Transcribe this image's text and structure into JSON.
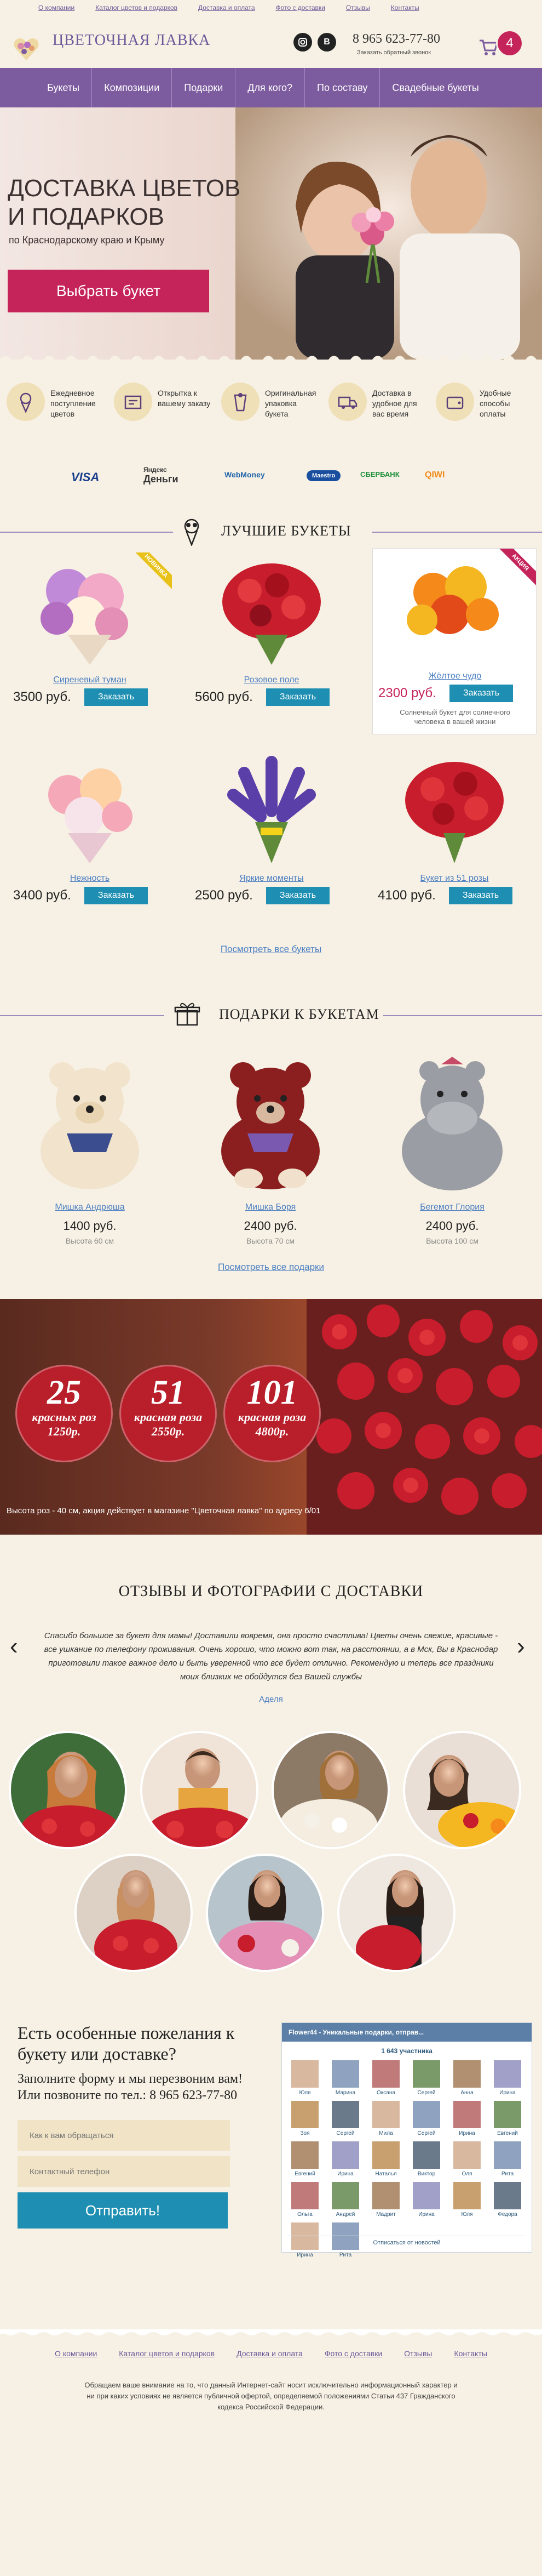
{
  "top_nav": [
    "О компании",
    "Каталог цветов и подарков",
    "Доставка и оплата",
    "Фото с доставки",
    "Отзывы",
    "Контакты"
  ],
  "header": {
    "logo_text": "ЦВЕТОЧНАЯ ЛАВКА",
    "phone": "8 965 623-77-80",
    "callback_label": "Заказать обратный звонок",
    "cart_count": "4",
    "social": [
      {
        "icon": "instagram-icon"
      },
      {
        "icon": "vk-icon",
        "label": "В"
      }
    ]
  },
  "main_nav": [
    "Букеты",
    "Композиции",
    "Подарки",
    "Для кого?",
    "По составу",
    "Свадебные букеты"
  ],
  "hero": {
    "title_1": "ДОСТАВКА ЦВЕТОВ",
    "title_2": "И ПОДАРКОВ",
    "subtitle": "по Краснодарскому краю и Крыму",
    "button": "Выбрать букет"
  },
  "features": [
    {
      "icon": "bouquet-icon",
      "text": "Ежедневное поступление цветов"
    },
    {
      "icon": "card-icon",
      "text": "Открытка к вашему заказу"
    },
    {
      "icon": "package-icon",
      "text": "Оригинальная упаковка букета"
    },
    {
      "icon": "truck-icon",
      "text": "Доставка в удобное для вас время"
    },
    {
      "icon": "wallet-icon",
      "text": "Удобные способы оплаты"
    }
  ],
  "payments": {
    "visa": "VISA",
    "yandex_1": "Яндекс",
    "yandex_2": "Деньги",
    "webmoney": "WebMoney",
    "maestro": "Maestro",
    "sberbank": "СБЕРБАНК",
    "qiwi": "QIWI"
  },
  "best": {
    "title": "ЛУЧШИЕ БУКЕТЫ",
    "order_label": "Заказать",
    "see_all": "Посмотреть все букеты",
    "items": [
      {
        "name": "Сиреневый туман",
        "price": "3500 руб.",
        "badge": "НОВИНКА",
        "colors": [
          "#c18ad9",
          "#f2a9c8",
          "#fff3e0"
        ]
      },
      {
        "name": "Розовое поле",
        "price": "5600 руб.",
        "colors": [
          "#c81d2c",
          "#e23a3f",
          "#8f0f1c"
        ]
      },
      {
        "name": "Жёлтое чудо",
        "price": "2300 руб.",
        "badge": "АКЦИЯ",
        "desc": "Солнечный букет для солнечного человека в вашей жизни",
        "colors": [
          "#f58a1b",
          "#f4b722",
          "#e24a1a"
        ]
      },
      {
        "name": "Нежность",
        "price": "3400 руб.",
        "colors": [
          "#f5a9b8",
          "#fdd1a3",
          "#f7e3ea"
        ]
      },
      {
        "name": "Яркие моменты",
        "price": "2500 руб.",
        "colors": [
          "#5a3fa8",
          "#7b5bcf",
          "#3e2c82"
        ]
      },
      {
        "name": "Букет из 51 розы",
        "price": "4100 руб.",
        "colors": [
          "#c81d2c",
          "#a5101d",
          "#e0343b"
        ]
      }
    ]
  },
  "gifts": {
    "title": "ПОДАРКИ К БУКЕТАМ",
    "see_all": "Посмотреть все подарки",
    "items": [
      {
        "name": "Мишка Андрюша",
        "price": "1400 руб.",
        "height": "Высота 60 см",
        "color": "#f2e4cc",
        "accent": "#3b4d8e"
      },
      {
        "name": "Мишка Боря",
        "price": "2400 руб.",
        "height": "Высота 70 см",
        "color": "#8b1e1e",
        "accent": "#7a5ab0"
      },
      {
        "name": "Бегемот Глория",
        "price": "2400 руб.",
        "height": "Высота 100 см",
        "color": "#9a9da3",
        "accent": "#c64b66"
      }
    ]
  },
  "promo": {
    "offers": [
      {
        "num": "25",
        "line1": "красных роз",
        "line2": "1250р."
      },
      {
        "num": "51",
        "line1": "красная роза",
        "line2": "2550р."
      },
      {
        "num": "101",
        "line1": "красная роза",
        "line2": "4800р."
      }
    ],
    "note": "Высота роз - 40 см, акция действует в магазине \"Цветочная лавка\" по адресу 6/01"
  },
  "reviews": {
    "title": "ОТЗЫВЫ И ФОТОГРАФИИ С ДОСТАВКИ",
    "text": "Спасибо большое за букет для мамы! Доставили вовремя, она просто счастлива! Цветы очень свежие, красивые - все ушкание по телефону проживания. Очень хорошо, что можно вот так, на расстоянии, а в Мск, Вы в Краснодар приготовили такое важное дело и быть уверенной что все будет отлично. Рекомендую и теперь все праздники моих близких не обойдутся без Вашей службы",
    "author": "Аделя"
  },
  "contact": {
    "title": "Есть особенные пожелания к букету или доставке?",
    "sub_1": "Заполните форму и мы перезвоним вам!",
    "sub_2": "Или позвоните по тел.: 8 965 623-77-80",
    "name_placeholder": "Как к вам обращаться",
    "phone_placeholder": "Контактный телефон",
    "button": "Отправить!",
    "vk": {
      "group": "Flower44 - Уникальные подарки, отправ...",
      "members": "1 643 участника",
      "unsubscribe": "Отписаться от новостей",
      "people": [
        "Юля",
        "Марина",
        "Оксана",
        "Сергей",
        "Анна",
        "Ирина",
        "Зоя",
        "Сергей",
        "Мила",
        "Сергей",
        "Ирина",
        "Евгений",
        "Евгений",
        "Ирина",
        "Наталья",
        "Виктор",
        "Оля",
        "Рита",
        "Ольга",
        "Андрей",
        "Мадрит",
        "Ирина",
        "Юля",
        "Федора",
        "Ирина",
        "Рита"
      ]
    }
  },
  "footer": {
    "nav": [
      "О компании",
      "Каталог цветов и подарков",
      "Доставка и оплата",
      "Фото с доставки",
      "Отзывы",
      "Контакты"
    ],
    "note": "Обращаем ваше внимание на то, что данный Интернет-сайт носит исключительно информационный характер и ни при каких условиях не является публичной офертой, определяемой положениями Статьи 437 Гражданского кодекса Российской Федерации."
  },
  "colors": {
    "purple": "#7d5b9f",
    "pink": "#c5245b",
    "blue": "#1e8fb2",
    "cream": "#f7f1e5"
  }
}
